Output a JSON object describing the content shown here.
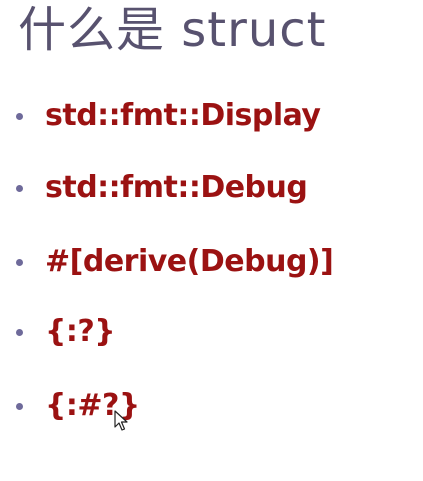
{
  "slide": {
    "title": "什么是 struct",
    "bullets": [
      {
        "text": "std::fmt::Display"
      },
      {
        "text": "std::fmt::Debug"
      },
      {
        "text": "#[derive(Debug)]"
      },
      {
        "text": "{:?}"
      },
      {
        "text": "{:#?}"
      }
    ]
  },
  "colors": {
    "title": "#58526f",
    "bullet_text": "#9b1212",
    "bullet_dot": "#6e6a9a",
    "background": "#ffffff"
  },
  "icons": {
    "cursor": "mouse-pointer-icon"
  }
}
